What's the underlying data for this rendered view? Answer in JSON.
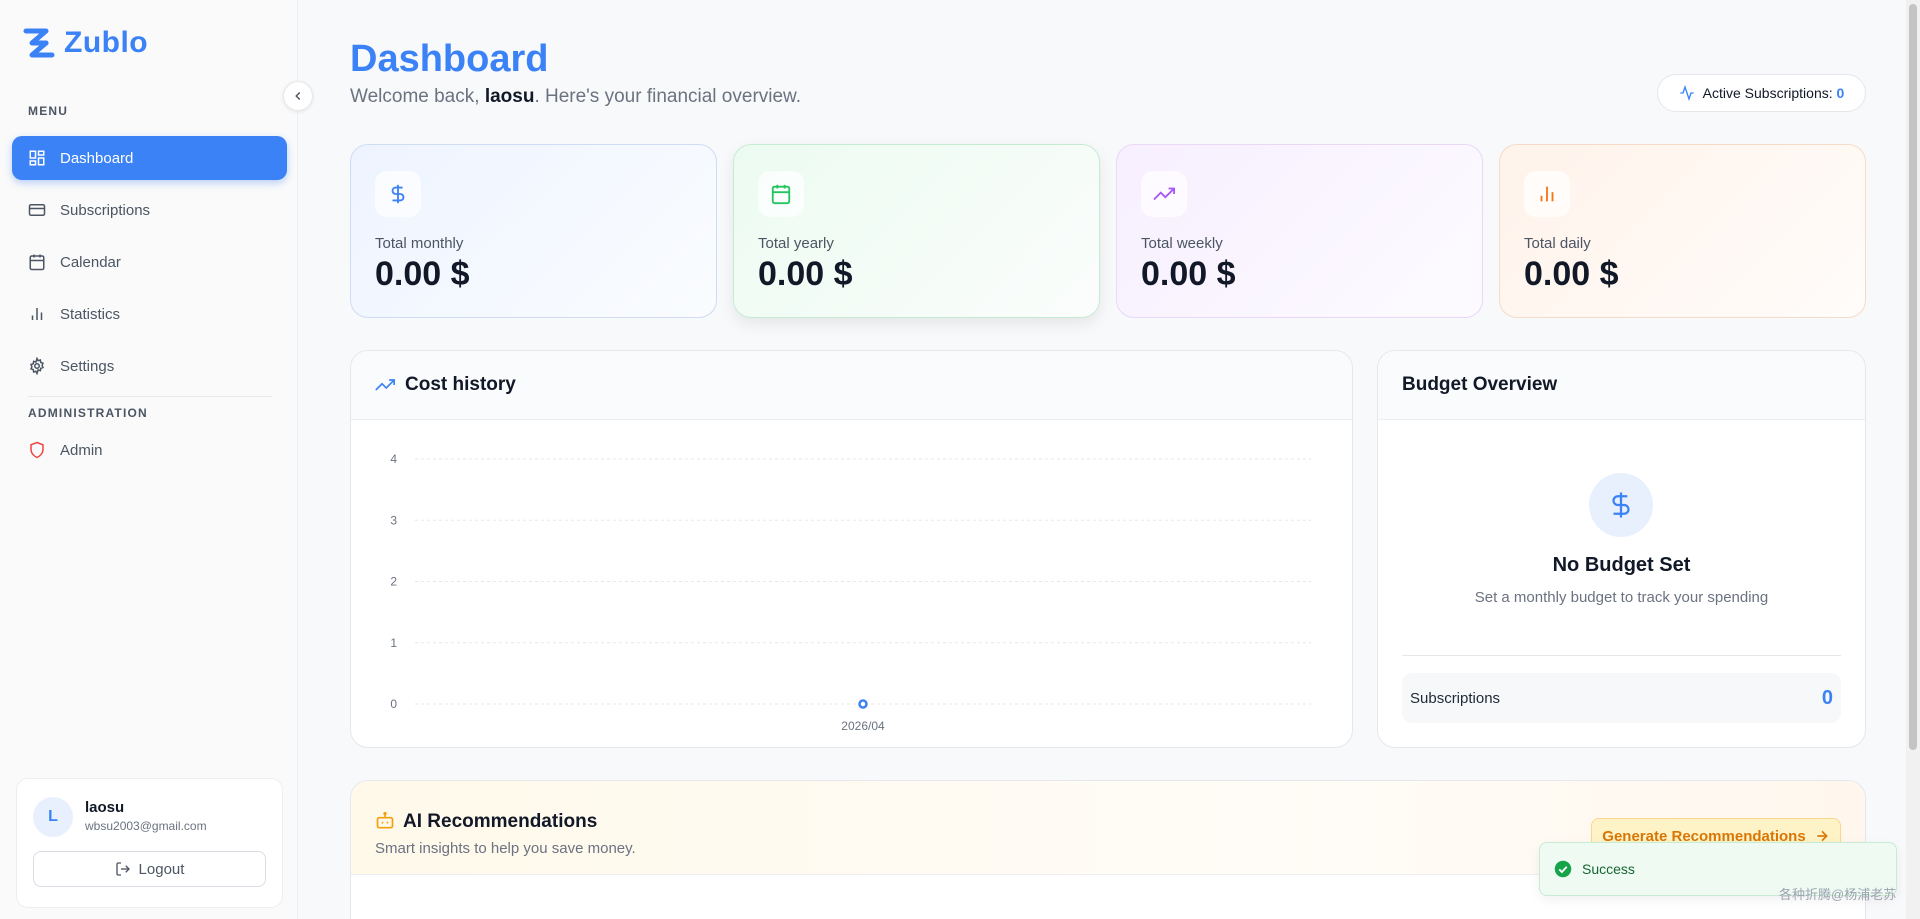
{
  "app": {
    "name": "Zublo"
  },
  "sidebar": {
    "menu_label": "MENU",
    "admin_label": "ADMINISTRATION",
    "items": [
      {
        "label": "Dashboard",
        "icon": "dashboard-icon",
        "active": true
      },
      {
        "label": "Subscriptions",
        "icon": "credit-card-icon"
      },
      {
        "label": "Calendar",
        "icon": "calendar-icon"
      },
      {
        "label": "Statistics",
        "icon": "bar-chart-icon"
      },
      {
        "label": "Settings",
        "icon": "gear-icon"
      }
    ],
    "admin_item": {
      "label": "Admin",
      "icon": "shield-icon"
    },
    "user": {
      "initial": "L",
      "name": "laosu",
      "email": "wbsu2003@gmail.com",
      "logout_label": "Logout"
    }
  },
  "header": {
    "title": "Dashboard",
    "welcome_prefix": "Welcome back, ",
    "username": "laosu",
    "welcome_suffix": ". Here's your financial overview.",
    "active_subs_label": "Active Subscriptions: ",
    "active_subs_count": "0"
  },
  "stats": [
    {
      "label": "Total monthly",
      "value": "0.00 $",
      "icon": "dollar-icon",
      "color": "#3b82f6"
    },
    {
      "label": "Total yearly",
      "value": "0.00 $",
      "icon": "calendar-icon",
      "color": "#22c55e"
    },
    {
      "label": "Total weekly",
      "value": "0.00 $",
      "icon": "trending-up-icon",
      "color": "#a855f7"
    },
    {
      "label": "Total daily",
      "value": "0.00 $",
      "icon": "bar-chart-icon",
      "color": "#f97316"
    }
  ],
  "cost_history": {
    "title": "Cost history",
    "chart_data": {
      "type": "line",
      "title": "Cost history",
      "x": [
        "2026/04"
      ],
      "series": [
        {
          "values": [
            0
          ]
        }
      ],
      "ylim": [
        0,
        4
      ],
      "yticks": [
        "0",
        "1",
        "2",
        "3",
        "4"
      ],
      "grid": true
    }
  },
  "budget": {
    "title": "Budget Overview",
    "empty_title": "No Budget Set",
    "empty_desc": "Set a monthly budget to track your spending",
    "subs_label": "Subscriptions",
    "subs_count": "0"
  },
  "ai": {
    "title": "AI Recommendations",
    "subtitle": "Smart insights to help you save money.",
    "button_label": "Generate Recommendations"
  },
  "toast": {
    "message": "Success"
  },
  "watermark": "各种折腾@杨浦老苏",
  "colors": {
    "accent": "#3b82f6",
    "success": "#22c55e",
    "warning": "#d97706"
  }
}
